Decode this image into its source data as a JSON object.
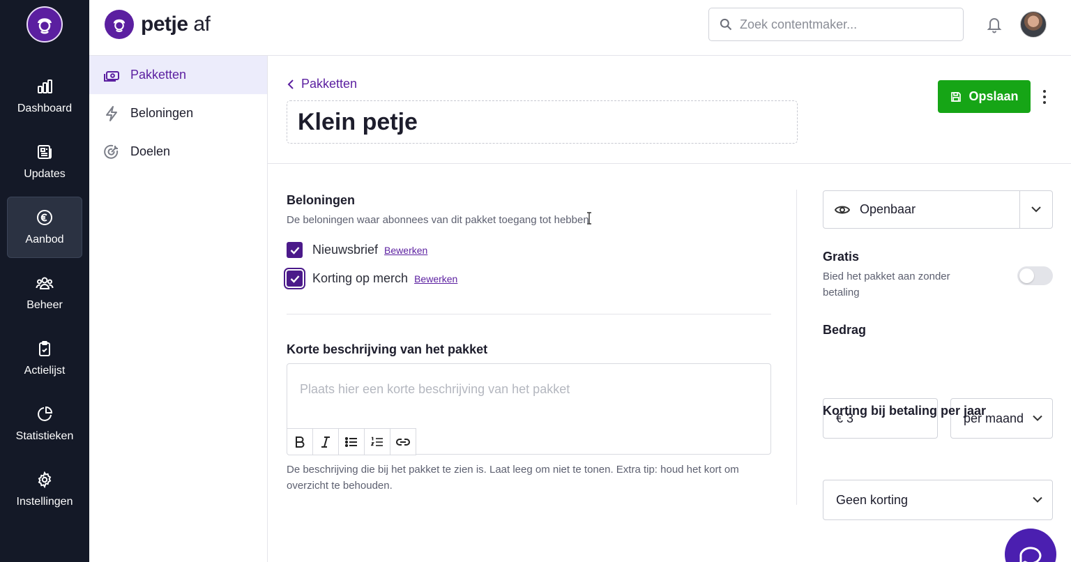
{
  "brand": {
    "name_bold": "petje",
    "name_light": "af"
  },
  "rail": {
    "items": [
      {
        "label": "Dashboard",
        "icon": "bar-chart-icon"
      },
      {
        "label": "Updates",
        "icon": "newspaper-icon"
      },
      {
        "label": "Aanbod",
        "icon": "euro-icon",
        "active": true
      },
      {
        "label": "Beheer",
        "icon": "users-icon"
      },
      {
        "label": "Actielijst",
        "icon": "clipboard-check-icon"
      },
      {
        "label": "Statistieken",
        "icon": "pie-chart-icon"
      },
      {
        "label": "Instellingen",
        "icon": "gear-icon"
      }
    ]
  },
  "search": {
    "placeholder": "Zoek contentmaker..."
  },
  "subnav": {
    "items": [
      {
        "label": "Pakketten",
        "icon": "money-stack-icon",
        "active": true
      },
      {
        "label": "Beloningen",
        "icon": "lightning-icon"
      },
      {
        "label": "Doelen",
        "icon": "target-icon"
      }
    ]
  },
  "header": {
    "back_label": "Pakketten",
    "title": "Klein petje",
    "save_label": "Opslaan"
  },
  "rewards": {
    "title": "Beloningen",
    "description": "De beloningen waar abonnees van dit pakket toegang tot hebben",
    "items": [
      {
        "label": "Nieuwsbrief",
        "edit": "Bewerken",
        "checked": true
      },
      {
        "label": "Korting op merch",
        "edit": "Bewerken",
        "checked": true
      }
    ]
  },
  "description": {
    "title": "Korte beschrijving van het pakket",
    "placeholder": "Plaats hier een korte beschrijving van het pakket",
    "help": "De beschrijving die bij het pakket te zien is. Laat leeg om niet te tonen. Extra tip: houd het kort om overzicht te behouden.",
    "toolbar": [
      "bold-icon",
      "italic-icon",
      "bullet-list-icon",
      "numbered-list-icon",
      "link-icon"
    ]
  },
  "settings": {
    "visibility": "Openbaar",
    "free_title": "Gratis",
    "free_desc_line1": "Bied het pakket aan zonder",
    "free_desc_line2": "betaling",
    "free_enabled": false,
    "amount_title": "Bedrag",
    "amount_value": "€ 3",
    "period_value": "per maand",
    "discount_title": "Korting bij betaling per jaar",
    "discount_value": "Geen korting"
  },
  "colors": {
    "brand": "#5b1fa0",
    "rail_bg": "#141927",
    "save_green": "#16a516",
    "checkbox": "#4b1a8a",
    "active_subnav_bg": "#ececfb"
  }
}
